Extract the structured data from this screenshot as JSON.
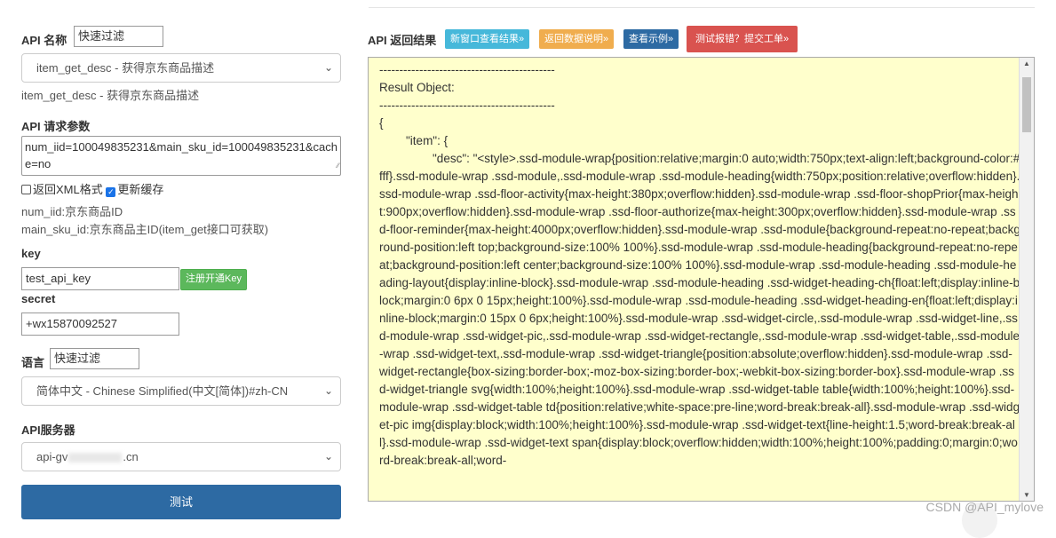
{
  "left": {
    "api_name_label": "API 名称",
    "api_filter_placeholder": "快速过滤",
    "api_select_value": "item_get_desc - 获得京东商品描述",
    "api_desc": "item_get_desc - 获得京东商品描述",
    "params_label": "API 请求参数",
    "params_value": "num_iid=100049835231&main_sku_id=100049835231&cache=no",
    "xml_label": "返回XML格式",
    "cache_label": "更新缓存",
    "param_hint_1": "num_iid:京东商品ID",
    "param_hint_2": "main_sku_id:京东商品主ID(item_get接口可获取)",
    "key_label": "key",
    "key_value": "test_api_key",
    "register_key_button": "注册开通Key",
    "secret_label": "secret",
    "secret_value": "+wx15870092527",
    "lang_label": "语言",
    "lang_filter_placeholder": "快速过滤",
    "lang_select_value": "简体中文 - Chinese Simplified(中文[简体])#zh-CN",
    "server_label": "API服务器",
    "server_prefix": "api-gv",
    "server_suffix": ".cn",
    "test_button": "测试"
  },
  "right": {
    "title": "API 返回结果",
    "buttons": [
      {
        "label": "新窗口查看结果»",
        "color": "#46b8da"
      },
      {
        "label": "返回数据说明»",
        "color": "#f0ad4e"
      },
      {
        "label": "查看示例»",
        "color": "#2d6aa3"
      },
      {
        "label": "测试报错？提交工单»",
        "color": "#d9534f"
      }
    ],
    "result_lines": [
      "--------------------------------------------",
      "Result Object:",
      "--------------------------------------------",
      "{",
      "        \"item\": {",
      "                \"desc\": \"<style>.ssd-module-wrap{position:relative;margin:0 auto;width:750px;text-align:left;background-color:#fff}.ssd-module-wrap .ssd-module,.ssd-module-wrap .ssd-module-heading{width:750px;position:relative;overflow:hidden}.ssd-module-wrap .ssd-floor-activity{max-height:380px;overflow:hidden}.ssd-module-wrap .ssd-floor-shopPrior{max-height:900px;overflow:hidden}.ssd-module-wrap .ssd-floor-authorize{max-height:300px;overflow:hidden}.ssd-module-wrap .ssd-floor-reminder{max-height:4000px;overflow:hidden}.ssd-module-wrap .ssd-module{background-repeat:no-repeat;background-position:left top;background-size:100% 100%}.ssd-module-wrap .ssd-module-heading{background-repeat:no-repeat;background-position:left center;background-size:100% 100%}.ssd-module-wrap .ssd-module-heading .ssd-module-heading-layout{display:inline-block}.ssd-module-wrap .ssd-module-heading .ssd-widget-heading-ch{float:left;display:inline-block;margin:0 6px 0 15px;height:100%}.ssd-module-wrap .ssd-module-heading .ssd-widget-heading-en{float:left;display:inline-block;margin:0 15px 0 6px;height:100%}.ssd-module-wrap .ssd-widget-circle,.ssd-module-wrap .ssd-widget-line,.ssd-module-wrap .ssd-widget-pic,.ssd-module-wrap .ssd-widget-rectangle,.ssd-module-wrap .ssd-widget-table,.ssd-module-wrap .ssd-widget-text,.ssd-module-wrap .ssd-widget-triangle{position:absolute;overflow:hidden}.ssd-module-wrap .ssd-widget-rectangle{box-sizing:border-box;-moz-box-sizing:border-box;-webkit-box-sizing:border-box}.ssd-module-wrap .ssd-widget-triangle svg{width:100%;height:100%}.ssd-module-wrap .ssd-widget-table table{width:100%;height:100%}.ssd-module-wrap .ssd-widget-table td{position:relative;white-space:pre-line;word-break:break-all}.ssd-module-wrap .ssd-widget-pic img{display:block;width:100%;height:100%}.ssd-module-wrap .ssd-widget-text{line-height:1.5;word-break:break-all}.ssd-module-wrap .ssd-widget-text span{display:block;overflow:hidden;width:100%;height:100%;padding:0;margin:0;word-break:break-all;word-"
    ]
  },
  "watermark": "CSDN @API_mylove"
}
